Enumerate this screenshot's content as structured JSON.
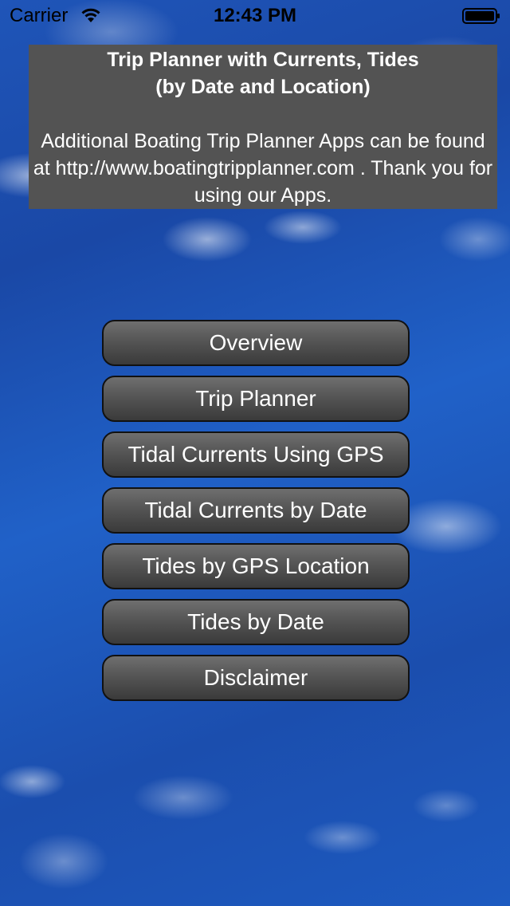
{
  "status_bar": {
    "carrier": "Carrier",
    "time": "12:43 PM",
    "icons": [
      "wifi-icon",
      "battery-icon"
    ]
  },
  "info_panel": {
    "title_line_1": "Trip Planner with Currents, Tides",
    "title_line_2": "(by Date and Location)",
    "message": "Additional Boating Trip Planner Apps can be found at http://www.boatingtripplanner.com . Thank you for using our Apps."
  },
  "menu": {
    "items": [
      {
        "label": "Overview"
      },
      {
        "label": "Trip Planner"
      },
      {
        "label": "Tidal Currents Using GPS"
      },
      {
        "label": "Tidal Currents by Date"
      },
      {
        "label": "Tides by GPS Location"
      },
      {
        "label": "Tides by Date"
      },
      {
        "label": "Disclaimer"
      }
    ]
  },
  "colors": {
    "panel_bg": "#535353",
    "button_bg": "#4a4a4a",
    "button_border": "#111111",
    "ocean_blue": "#1f55b8",
    "text": "#ffffff"
  }
}
